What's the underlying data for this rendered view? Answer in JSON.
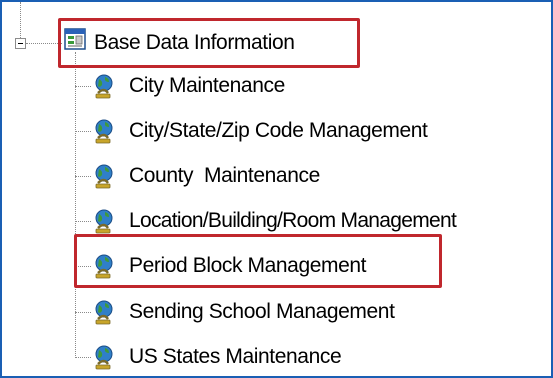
{
  "tree": {
    "root": {
      "label": "Base Data Information",
      "icon": "form-window-icon",
      "expanded": true
    },
    "children": [
      {
        "label": "City Maintenance",
        "icon": "globe-icon"
      },
      {
        "label": "City/State/Zip Code Management",
        "icon": "globe-icon"
      },
      {
        "label": "County  Maintenance",
        "icon": "globe-icon"
      },
      {
        "label": "Location/Building/Room Management",
        "icon": "globe-icon"
      },
      {
        "label": "Period Block Management",
        "icon": "globe-icon"
      },
      {
        "label": "Sending School Management",
        "icon": "globe-icon"
      },
      {
        "label": "US States Maintenance",
        "icon": "globe-icon"
      }
    ]
  },
  "highlights": {
    "color": "#c0272d",
    "items": [
      "Base Data Information",
      "Period Block Management"
    ]
  },
  "colors": {
    "frame": "#1a5fb4",
    "tree_lines": "#8a8a8a"
  }
}
